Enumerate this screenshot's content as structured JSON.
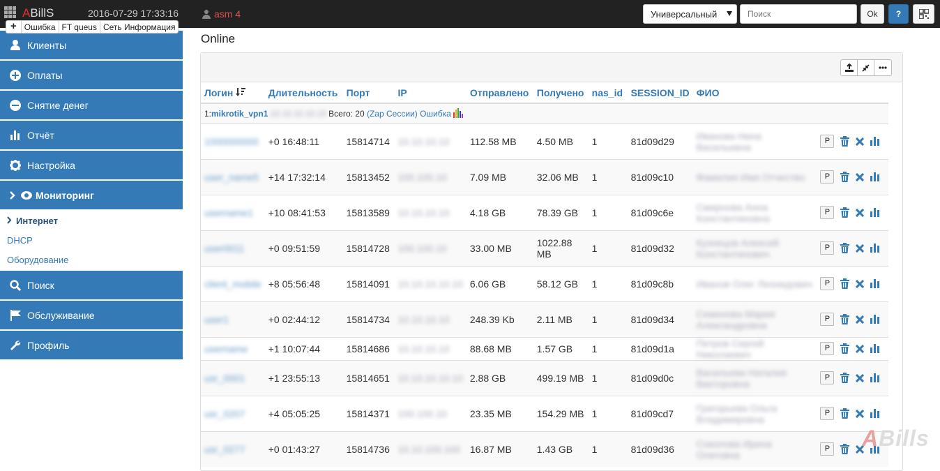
{
  "app": {
    "logo_a": "A",
    "logo_rest": "BillS",
    "datetime": "2016-07-29 17:33:16",
    "user": "asm 4"
  },
  "header": {
    "search_type": "Универсальный",
    "search_placeholder": "Поиск",
    "ok_label": "Ok",
    "help_label": "?"
  },
  "quick_tabs": [
    "+",
    "Ошибка",
    "FT queus",
    "Сеть Информация"
  ],
  "sidebar": {
    "items": [
      {
        "label": "Клиенты",
        "icon": "user-icon"
      },
      {
        "label": "Оплаты",
        "icon": "plus-circle-icon"
      },
      {
        "label": "Снятие денег",
        "icon": "minus-circle-icon"
      },
      {
        "label": "Отчёт",
        "icon": "bar-chart-icon"
      },
      {
        "label": "Настройка",
        "icon": "gear-icon"
      },
      {
        "label": "Мониторинг",
        "icon": "eye-icon"
      }
    ],
    "subitems": [
      "Интернет",
      "DHCP",
      "Оборудование"
    ],
    "items2": [
      {
        "label": "Поиск",
        "icon": "search-icon"
      },
      {
        "label": "Обслуживание",
        "icon": "flag-icon"
      },
      {
        "label": "Профиль",
        "icon": "wrench-icon"
      }
    ]
  },
  "page": {
    "title": "Online"
  },
  "table": {
    "headers": [
      "Логин",
      "Длительность",
      "Порт",
      "IP",
      "Отправлено",
      "Получено",
      "nas_id",
      "SESSION_ID",
      "ФИО"
    ],
    "filter": {
      "prefix": "1:",
      "nas_name": "mikrotik_vpn1",
      "nas_ip": ".10.10.10.10.10",
      "total": "Всего: 20",
      "zap": "(Zap Сессии)",
      "error": "Ошибка"
    },
    "rows": [
      {
        "login": "1000000000",
        "duration": "+0 16:48:11",
        "port": "15814714",
        "ip": "10.10.10.10",
        "sent": "112.58 MB",
        "recv": "4.50 MB",
        "nas": "1",
        "session": "81d09d29",
        "fio": "Иванова Нина Васильевна"
      },
      {
        "login": "user_name5",
        "duration": "+14 17:32:14",
        "port": "15813452",
        "ip": "100.100.10",
        "sent": "7.09 MB",
        "recv": "32.06 MB",
        "nas": "1",
        "session": "81d09c10",
        "fio": "Фамилия Имя Отчество"
      },
      {
        "login": "username1",
        "duration": "+10 08:41:53",
        "port": "15813589",
        "ip": "10.10.10.10",
        "sent": "4.18 GB",
        "recv": "78.39 GB",
        "nas": "1",
        "session": "81d09c6e",
        "fio": "Смирнова Анна Константиновна"
      },
      {
        "login": "user0011",
        "duration": "+0 09:51:59",
        "port": "15814728",
        "ip": "100.100.10",
        "sent": "33.00 MB",
        "recv": "1022.88 MB",
        "nas": "1",
        "session": "81d09d32",
        "fio": "Кузнецов Алексей Константинович"
      },
      {
        "login": "client_mobile",
        "duration": "+8 05:56:48",
        "port": "15814091",
        "ip": "10.10.10.10.10",
        "sent": "6.06 GB",
        "recv": "58.12 GB",
        "nas": "1",
        "session": "81d09c8b",
        "fio": "Иванов Олег Леонидович"
      },
      {
        "login": "user1",
        "duration": "+0 02:44:12",
        "port": "15814734",
        "ip": "10.10.10.10",
        "sent": "248.39 Kb",
        "recv": "2.11 MB",
        "nas": "1",
        "session": "81d09d34",
        "fio": "Семенова Мария Александровна"
      },
      {
        "login": "username",
        "duration": "+1 10:07:44",
        "port": "15814686",
        "ip": "10.10.10.10",
        "sent": "88.68 MB",
        "recv": "1.57 GB",
        "nas": "1",
        "session": "81d09d1a",
        "fio": "Петров Сергей Николаевич"
      },
      {
        "login": "usr_0001",
        "duration": "+1 23:55:13",
        "port": "15814651",
        "ip": "10.10.10.10.10",
        "sent": "2.88 GB",
        "recv": "499.19 MB",
        "nas": "1",
        "session": "81d09d0c",
        "fio": "Васильева Наталия Викторовна"
      },
      {
        "login": "usr_0207",
        "duration": "+4 05:05:25",
        "port": "15814371",
        "ip": "100.100.10",
        "sent": "23.35 MB",
        "recv": "154.29 MB",
        "nas": "1",
        "session": "81d09cd7",
        "fio": "Григорьева Ольга Владимировна"
      },
      {
        "login": "usr_0277",
        "duration": "+0 01:43:27",
        "port": "15814736",
        "ip": "10.10.100.100",
        "sent": "16.87 MB",
        "recv": "1.43 GB",
        "nas": "1",
        "session": "81d09d36",
        "fio": "Соколова Ирина Олеговна"
      }
    ],
    "row_button": "P"
  },
  "watermark": {
    "a": "A",
    "rest": "Bills"
  },
  "colors": {
    "primary": "#337ab7",
    "topbar": "#222222",
    "logo_red": "#e03030"
  }
}
